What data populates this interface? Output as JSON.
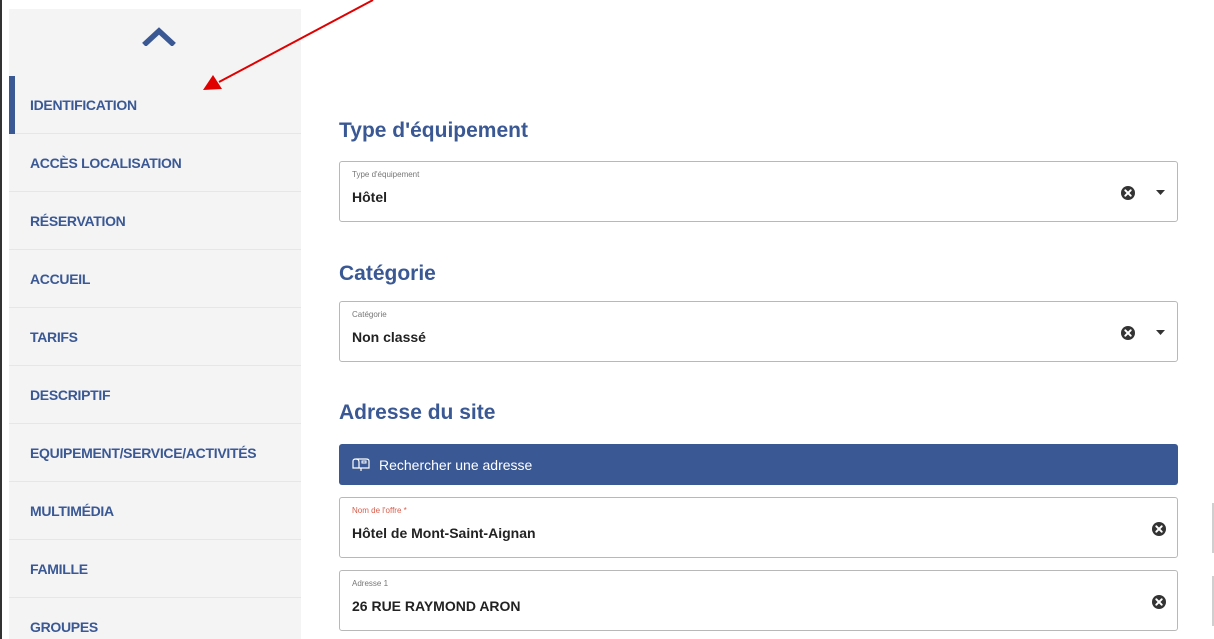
{
  "sidebar": {
    "collapse_icon": "chevron-up-icon",
    "items": [
      {
        "label": "IDENTIFICATION",
        "active": true
      },
      {
        "label": "ACCÈS LOCALISATION",
        "active": false
      },
      {
        "label": "RÉSERVATION",
        "active": false
      },
      {
        "label": "ACCUEIL",
        "active": false
      },
      {
        "label": "TARIFS",
        "active": false
      },
      {
        "label": "DESCRIPTIF",
        "active": false
      },
      {
        "label": "EQUIPEMENT/SERVICE/ACTIVITÉS",
        "active": false
      },
      {
        "label": "MULTIMÉDIA",
        "active": false
      },
      {
        "label": "FAMILLE",
        "active": false
      },
      {
        "label": "GROUPES",
        "active": false
      }
    ]
  },
  "type_equipement": {
    "title": "Type d'équipement",
    "field_label": "Type d'équipement",
    "value": "Hôtel"
  },
  "categorie": {
    "title": "Catégorie",
    "field_label": "Catégorie",
    "value": "Non classé"
  },
  "adresse": {
    "title": "Adresse du site",
    "search_button": "Rechercher une adresse",
    "search_icon": "mailbox-icon",
    "nom_offre_label": "Nom de l'offre *",
    "nom_offre_value": "Hôtel de Mont-Saint-Aignan",
    "adresse1_label": "Adresse 1",
    "adresse1_value": "26 RUE RAYMOND ARON"
  },
  "colors": {
    "brand": "#3a5894",
    "sidebar_bg": "#f4f4f4",
    "required": "#d95c4a",
    "annotation": "#e00000"
  }
}
